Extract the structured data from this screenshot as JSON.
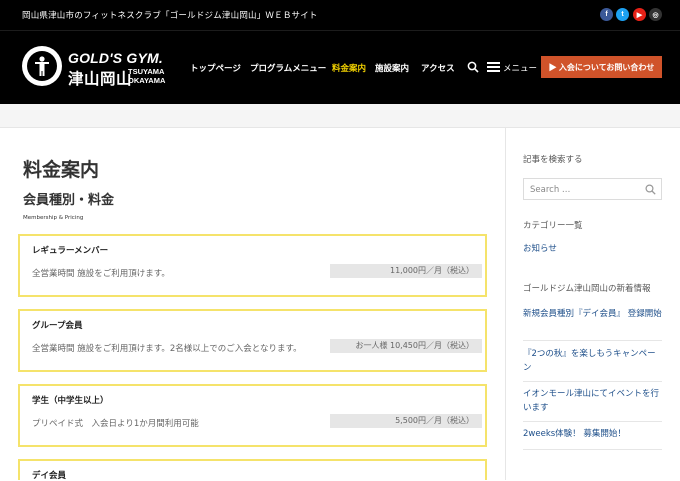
{
  "topbar": {
    "tagline": "岡山県津山市のフィットネスクラブ「ゴールドジム津山岡山」ＷＥＢサイト",
    "social": [
      {
        "name": "facebook-icon",
        "glyph": "f",
        "color": "#3b5998"
      },
      {
        "name": "twitter-icon",
        "glyph": "t",
        "color": "#1da1f2"
      },
      {
        "name": "youtube-icon",
        "glyph": "▶",
        "color": "#e62117"
      },
      {
        "name": "instagram-icon",
        "glyph": "◎",
        "color": "#333333"
      }
    ]
  },
  "header": {
    "brand": "GOLD'S GYM.",
    "brand_jp": "津山岡山",
    "brand_en_line1": "TSUYAMA",
    "brand_en_line2": "OKAYAMA",
    "nav": [
      {
        "label": "トップページ",
        "active": false
      },
      {
        "label": "プログラムメニュー",
        "active": false
      },
      {
        "label": "料金案内",
        "active": true
      },
      {
        "label": "施設案内",
        "active": false
      },
      {
        "label": "アクセス",
        "active": false
      }
    ],
    "menu_label": "メニュー",
    "cta_label": "▶ 入会についてお問い合わせ"
  },
  "main": {
    "title": "料金案内",
    "section_title": "会員種別・料金",
    "section_sub": "Membership & Pricing",
    "plans": [
      {
        "name": "レギュラーメンバー",
        "desc": "全営業時間 施設をご利用頂けます。",
        "price": "11,000円／月（税込）"
      },
      {
        "name": "グループ会員",
        "desc": "全営業時間 施設をご利用頂けます。2名様以上でのご入会となります。",
        "price": "お一人様 10,450円／月（税込）"
      },
      {
        "name": "学生（中学生以上）",
        "desc": "プリペイド式　入会日より1か月間利用可能",
        "price": "5,500円／月（税込）"
      },
      {
        "name": "デイ会員",
        "desc": "",
        "price": ""
      }
    ]
  },
  "sidebar": {
    "search_heading": "記事を検索する",
    "search_placeholder": "Search …",
    "category_heading": "カテゴリー一覧",
    "category_link": "お知らせ",
    "news_heading": "ゴールドジム津山岡山の新着情報",
    "news": [
      "新規会員種別『デイ会員』 登録開始",
      "『2つの秋』を楽しもうキャンペーン",
      "イオンモール津山にてイベントを行います",
      "2weeks体験！ 募集開始！"
    ]
  },
  "colors": {
    "accent": "#f0d000",
    "cta": "#d0532a",
    "card_border": "#f5e36b",
    "link": "#1e4f8a"
  }
}
